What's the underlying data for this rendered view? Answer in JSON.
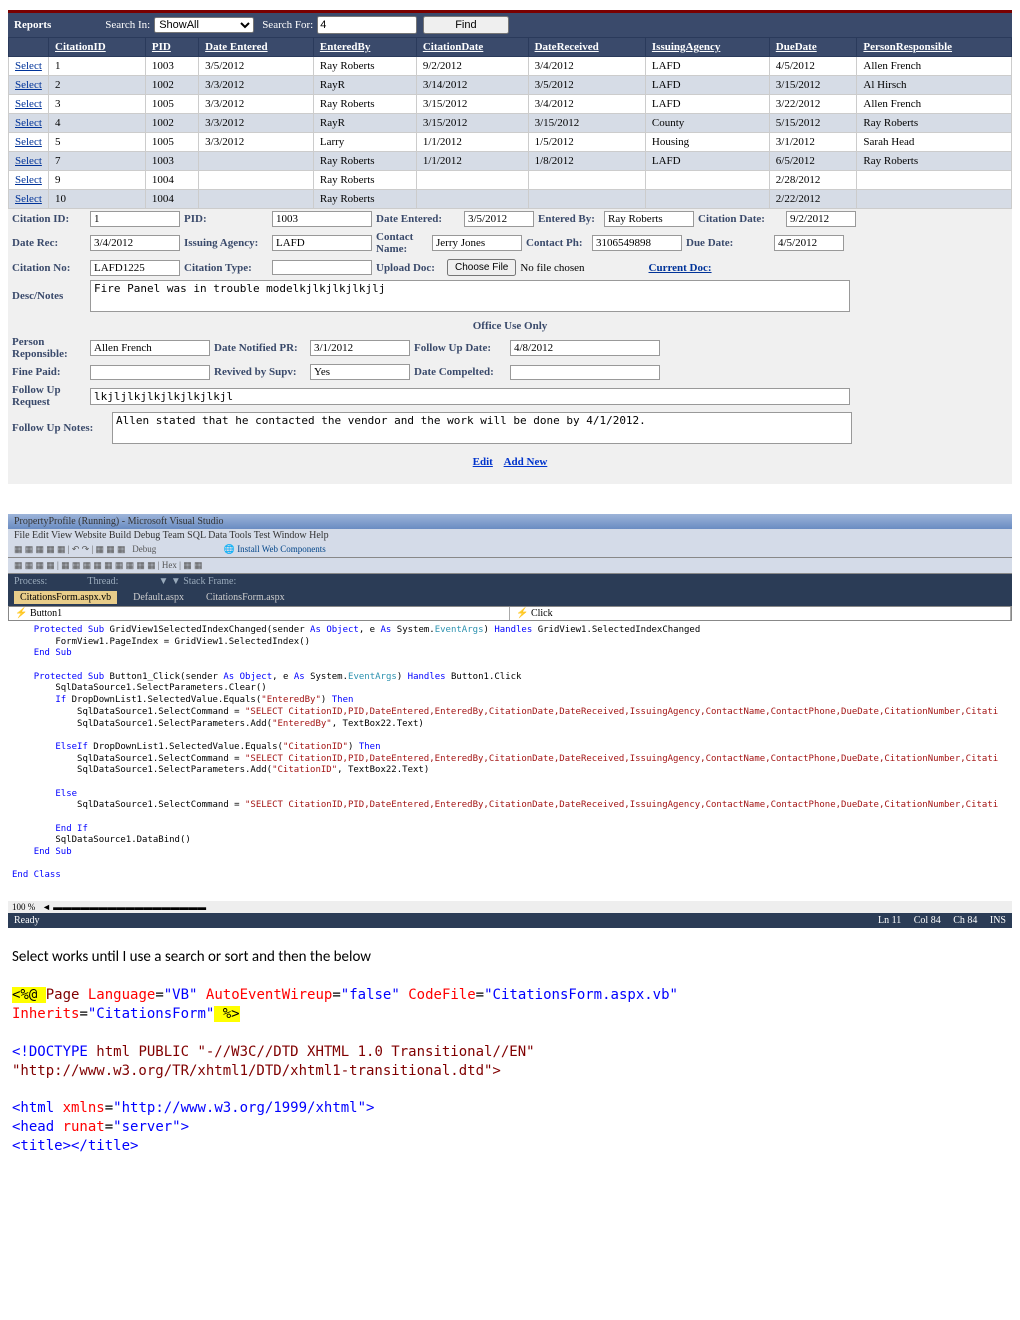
{
  "topbar": {
    "reports": "Reports",
    "search_in_label": "Search In:",
    "search_in_value": "ShowAll",
    "search_for_label": "Search For:",
    "search_for_value": "4",
    "find_label": "Find"
  },
  "grid": {
    "headers": [
      "",
      "CitationID",
      "PID",
      "Date Entered",
      "EnteredBy",
      "CitationDate",
      "DateReceived",
      "IssuingAgency",
      "DueDate",
      "PersonResponsible"
    ],
    "select_label": "Select",
    "rows": [
      [
        "1",
        "1003",
        "3/5/2012",
        "Ray Roberts",
        "9/2/2012",
        "3/4/2012",
        "LAFD",
        "4/5/2012",
        "Allen French"
      ],
      [
        "2",
        "1002",
        "3/3/2012",
        "RayR",
        "3/14/2012",
        "3/5/2012",
        "LAFD",
        "3/15/2012",
        "Al Hirsch"
      ],
      [
        "3",
        "1005",
        "3/3/2012",
        "Ray Roberts",
        "3/15/2012",
        "3/4/2012",
        "LAFD",
        "3/22/2012",
        "Allen French"
      ],
      [
        "4",
        "1002",
        "3/3/2012",
        "RayR",
        "3/15/2012",
        "3/15/2012",
        "County",
        "5/15/2012",
        "Ray Roberts"
      ],
      [
        "5",
        "1005",
        "3/3/2012",
        "Larry",
        "1/1/2012",
        "1/5/2012",
        "Housing",
        "3/1/2012",
        "Sarah Head"
      ],
      [
        "7",
        "1003",
        "",
        "Ray Roberts",
        "1/1/2012",
        "1/8/2012",
        "LAFD",
        "6/5/2012",
        "Ray Roberts"
      ],
      [
        "9",
        "1004",
        "",
        "Ray Roberts",
        "",
        "",
        "",
        "2/28/2012",
        ""
      ],
      [
        "10",
        "1004",
        "",
        "Ray Roberts",
        "",
        "",
        "",
        "2/22/2012",
        ""
      ]
    ]
  },
  "form": {
    "citation_id_label": "Citation ID:",
    "citation_id": "1",
    "pid_label": "PID:",
    "pid": "1003",
    "date_entered_label": "Date Entered:",
    "date_entered": "3/5/2012",
    "entered_by_label": "Entered By:",
    "entered_by": "Ray Roberts",
    "citation_date_label": "Citation Date:",
    "citation_date": "9/2/2012",
    "date_rec_label": "Date Rec:",
    "date_rec": "3/4/2012",
    "issuing_agency_label": "Issuing Agency:",
    "issuing_agency": "LAFD",
    "contact_name_label": "Contact Name:",
    "contact_name": "Jerry Jones",
    "contact_ph_label": "Contact Ph:",
    "contact_ph": "3106549898",
    "due_date_label": "Due Date:",
    "due_date": "4/5/2012",
    "citation_no_label": "Citation No:",
    "citation_no": "LAFD1225",
    "citation_type_label": "Citation Type:",
    "citation_type": "",
    "upload_doc_label": "Upload Doc:",
    "choose_file": "Choose File",
    "no_file": "No file chosen",
    "current_doc": "Current Doc:",
    "desc_notes_label": "Desc/Notes",
    "desc_notes": "Fire Panel was in trouble modelkjlkjlkjlkjlj",
    "office_use_only": "Office Use Only",
    "person_resp_label": "Person Reponsible:",
    "person_resp": "Allen French",
    "date_notified_pr_label": "Date Notified PR:",
    "date_notified_pr": "3/1/2012",
    "followup_date_label": "Follow Up Date:",
    "followup_date": "4/8/2012",
    "fine_paid_label": "Fine Paid:",
    "fine_paid": "",
    "revived_supv_label": "Revived by Supv:",
    "revived_supv": "Yes",
    "date_completed_label": "Date Compelted:",
    "date_completed": "",
    "followup_req_label": "Follow Up Request",
    "followup_req": "lkjljlkjlkjlkjlkjlkjl",
    "followup_notes_label": "Follow Up Notes:",
    "followup_notes": "Allen stated that he contacted the vendor and the work will be done by 4/1/2012.",
    "edit": "Edit",
    "addnew": "Add New"
  },
  "vs": {
    "titlebar": "PropertyProfile (Running) - Microsoft Visual Studio",
    "menubar": "File  Edit  View  Website  Build  Debug  Team  SQL  Data  Tools  Test  Window  Help",
    "toolbar1_text": "Debug",
    "toolbar_install": "Install Web Components",
    "tabs": {
      "active": "CitationsForm.aspx.vb",
      "t1": "Default.aspx",
      "t2": "CitationsForm.aspx"
    },
    "dd_left": "Button1",
    "dd_right": "Click",
    "status_left": "Ready",
    "status_ln": "Ln 11",
    "status_col": "Col 84",
    "status_ch": "Ch 84",
    "status_ins": "INS"
  },
  "prose_text": "Select works until I use a search or sort and then the below",
  "aspx": {
    "page_decl_pre": "<%@ ",
    "page_decl_end": " %>",
    "page": "Page",
    "lang_attr": "Language",
    "lang_val": "\"VB\"",
    "aew_attr": "AutoEventWireup",
    "aew_val": "\"false\"",
    "cf_attr": "CodeFile",
    "cf_val": "\"CitationsForm.aspx.vb\"",
    "inh_attr": "Inherits",
    "inh_val": "\"CitationsForm\"",
    "doctype1": "<!DOCTYPE ",
    "doctype1b": "html PUBLIC \"-//W3C//DTD XHTML 1.0 Transitional//EN\"",
    "doctype2": "\"http://www.w3.org/TR/xhtml1/DTD/xhtml1-transitional.dtd\">",
    "html_open": "<html ",
    "xmlns_attr": "xmlns",
    "xmlns_val": "\"http://www.w3.org/1999/xhtml\">",
    "head_open": "<head ",
    "runat_attr": "runat",
    "runat_val": "\"server\">",
    "title_tag": "  <title></title>"
  }
}
